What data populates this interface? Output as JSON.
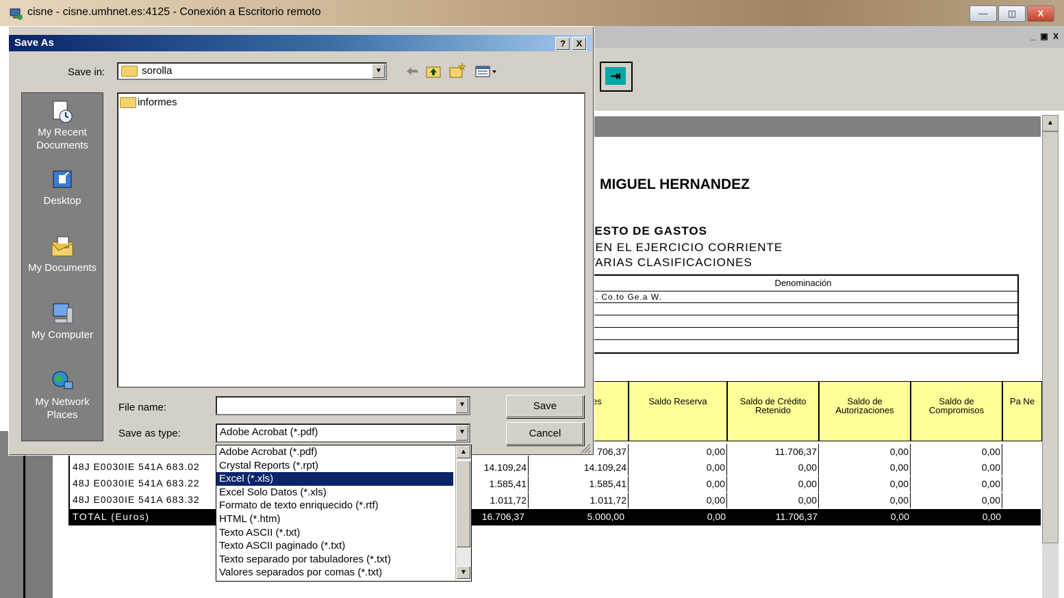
{
  "remote_desktop": {
    "title": "cisne - cisne.umhnet.es:4125 - Conexión a Escritorio remoto",
    "minimize": "—",
    "restore": "◫",
    "close": "X"
  },
  "app": {
    "mdi_controls": "_ ▣ X",
    "exit_button_glyph": "⇥"
  },
  "report": {
    "title": "MIGUEL HERNANDEZ",
    "subtitle1": "JESTO DE GASTOS",
    "subtitle2": "; EN EL EJERCICIO CORRIENTE",
    "subtitle3": "VARIAS CLASIFICACIONES",
    "denominacion_header": "Denominación",
    "denominacion_row1": "u. Co.to Ge.a W.",
    "columns": [
      {
        "label": "es"
      },
      {
        "label": "Saldo Reserva"
      },
      {
        "label": "Saldo de Crédito Retenido"
      },
      {
        "label": "Saldo de Autorizaciones"
      },
      {
        "label": "Saldo de Compromisos"
      },
      {
        "label": "Pa Ne"
      }
    ],
    "rows": [
      {
        "code": "",
        "values": [
          "",
          "706,37",
          "0,00",
          "11.706,37",
          "0,00",
          "0,00"
        ]
      },
      {
        "code": "48J E0030IE 541A 683.02",
        "values": [
          "14.109,24",
          "14.109,24",
          "0,00",
          "0,00",
          "0,00",
          "0,00"
        ]
      },
      {
        "code": "48J E0030IE 541A 683.22",
        "values": [
          "1.585,41",
          "1.585,41",
          "0,00",
          "0,00",
          "0,00",
          "0,00"
        ]
      },
      {
        "code": "48J E0030IE 541A 683.32",
        "values": [
          "1.011,72",
          "1.011,72",
          "0,00",
          "0,00",
          "0,00",
          "0,00"
        ]
      }
    ],
    "total": {
      "label": "TOTAL (Euros)",
      "values": [
        "16.706,37",
        "5.000,00",
        "0,00",
        "11.706,37",
        "0,00",
        "0,00"
      ]
    }
  },
  "dialog": {
    "title": "Save As",
    "help": "?",
    "close": "X",
    "save_in_label": "Save in:",
    "save_in_value": "sorolla",
    "places": [
      {
        "label": "My Recent Documents",
        "icon": "recent-documents-icon"
      },
      {
        "label": "Desktop",
        "icon": "desktop-icon"
      },
      {
        "label": "My Documents",
        "icon": "my-documents-icon"
      },
      {
        "label": "My Computer",
        "icon": "my-computer-icon"
      },
      {
        "label": "My Network Places",
        "icon": "network-places-icon"
      }
    ],
    "files": [
      "informes"
    ],
    "file_name_label": "File name:",
    "file_name_value": "",
    "save_type_label": "Save as type:",
    "save_type_value": "Adobe Acrobat (*.pdf)",
    "save_button": "Save",
    "cancel_button": "Cancel",
    "type_options": [
      "Adobe Acrobat (*.pdf)",
      "Crystal Reports (*.rpt)",
      "Excel (*.xls)",
      "Excel Solo Datos (*.xls)",
      "Formato de texto enriquecido (*.rtf)",
      "HTML (*.htm)",
      "Texto ASCII (*.txt)",
      "Texto ASCII paginado (*.txt)",
      "Texto separado por tabuladores (*.txt)",
      "Valores separados por comas (*.txt)"
    ],
    "selected_option_index": 2
  }
}
